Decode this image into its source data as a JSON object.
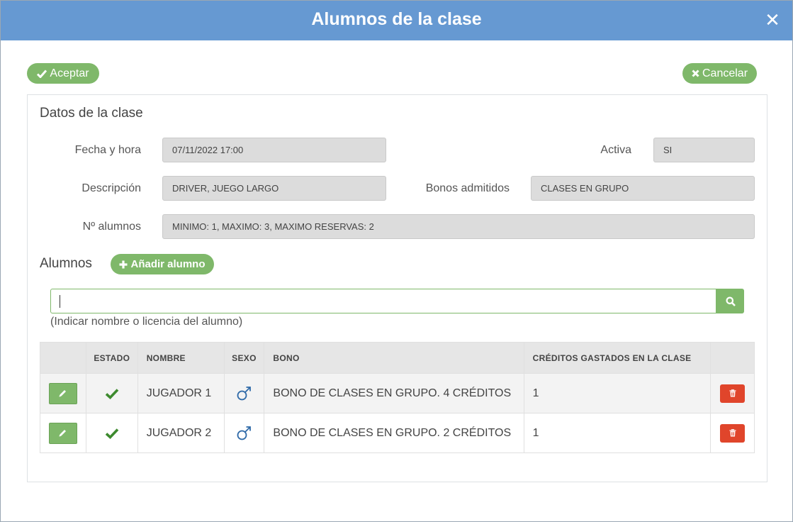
{
  "modal": {
    "title": "Alumnos de la clase",
    "close_icon": "close-icon"
  },
  "actions": {
    "accept_label": "Aceptar",
    "cancel_label": "Cancelar"
  },
  "class_data": {
    "section_title": "Datos de la clase",
    "fecha_label": "Fecha y hora",
    "fecha_value": "07/11/2022   17:00",
    "activa_label": "Activa",
    "activa_value": "SI",
    "descripcion_label": "Descripción",
    "descripcion_value": "DRIVER, JUEGO LARGO",
    "bonos_label": "Bonos admitidos",
    "bonos_value": "CLASES EN GRUPO",
    "alumnos_label": "Nº alumnos",
    "alumnos_value": "MINIMO: 1, MAXIMO: 3, MAXIMO RESERVAS: 2"
  },
  "students": {
    "section_title": "Alumnos",
    "add_label": "Añadir alumno",
    "search_value": "",
    "search_hint": "(Indicar nombre o licencia del alumno)",
    "columns": [
      "",
      "ESTADO",
      "NOMBRE",
      "SEXO",
      "BONO",
      "CRÉDITOS GASTADOS EN LA CLASE",
      ""
    ],
    "rows": [
      {
        "estado": "check-icon",
        "nombre": "JUGADOR 1",
        "sexo": "male-icon",
        "bono": "BONO DE CLASES EN GRUPO. 4 CRÉDITOS",
        "creditos": "1"
      },
      {
        "estado": "check-icon",
        "nombre": "JUGADOR 2",
        "sexo": "male-icon",
        "bono": "BONO DE CLASES EN GRUPO. 2 CRÉDITOS",
        "creditos": "1"
      }
    ]
  },
  "colors": {
    "header_blue": "#6699d2",
    "accent_green": "#7fb86a",
    "check_green": "#3d8a2e",
    "delete_red": "#e0452b",
    "male_blue": "#2f6aa8"
  }
}
